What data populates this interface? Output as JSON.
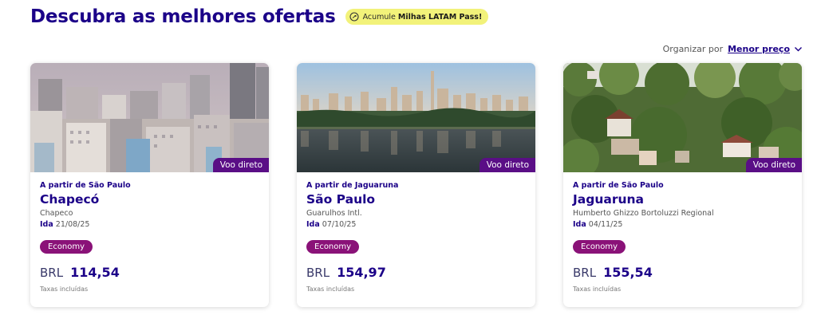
{
  "header": {
    "title": "Descubra as melhores ofertas",
    "promo_prefix": "Acumule",
    "promo_bold": "Milhas LATAM Pass!"
  },
  "sort": {
    "label": "Organizar por",
    "value": "Menor preço"
  },
  "cards": [
    {
      "badge": "Voo direto",
      "from": "A partir de São Paulo",
      "destination": "Chapecó",
      "airport": "Chapeco",
      "date_label": "Ida",
      "date": "21/08/25",
      "cabin": "Economy",
      "currency": "BRL",
      "price": "114,54",
      "taxes": "Taxas incluídas"
    },
    {
      "badge": "Voo direto",
      "from": "A partir de Jaguaruna",
      "destination": "São Paulo",
      "airport": "Guarulhos Intl.",
      "date_label": "Ida",
      "date": "07/10/25",
      "cabin": "Economy",
      "currency": "BRL",
      "price": "154,97",
      "taxes": "Taxas incluídas"
    },
    {
      "badge": "Voo direto",
      "from": "A partir de São Paulo",
      "destination": "Jaguaruna",
      "airport": "Humberto Ghizzo Bortoluzzi Regional",
      "date_label": "Ida",
      "date": "04/11/25",
      "cabin": "Economy",
      "currency": "BRL",
      "price": "155,54",
      "taxes": "Taxas incluídas"
    }
  ],
  "colors": {
    "brand": "#1b0088",
    "badge": "#5a0e86",
    "cabin": "#8a1278",
    "promo": "#f2f27a"
  }
}
